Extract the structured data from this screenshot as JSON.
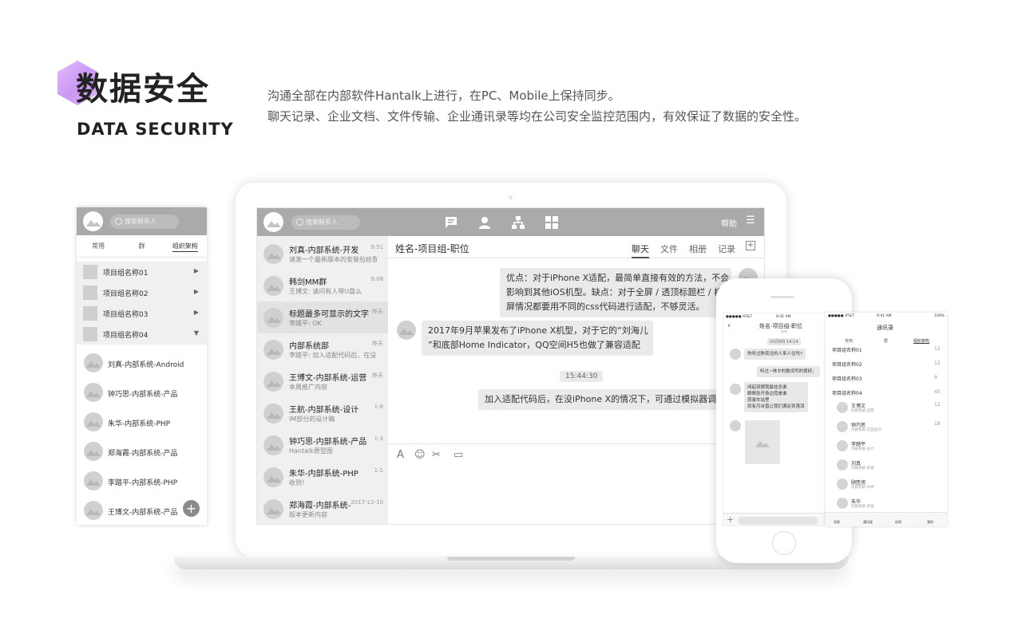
{
  "header": {
    "title_cn": "数据安全",
    "title_en": "DATA SECURITY",
    "desc_line1": "沟通全部在内部软件Hantalk上进行，在PC、Mobile上保持同步。",
    "desc_line2": "聊天记录、企业文档、文件传输、企业通讯录等均在公司安全监控范围内，有效保证了数据的安全性。"
  },
  "left_panel": {
    "search_placeholder": "搜索联系人",
    "tabs": [
      "常用",
      "群",
      "组织架构"
    ],
    "groups": [
      {
        "label": "项目组名称01",
        "arrow": "▶"
      },
      {
        "label": "项目组名称02",
        "arrow": "▶"
      },
      {
        "label": "项目组名称03",
        "arrow": "▶"
      },
      {
        "label": "项目组名称04",
        "arrow": "▼"
      }
    ],
    "members": [
      "刘真-内部系统-Android",
      "钟巧思-内部系统-产品",
      "朱华-内部系统-PHP",
      "郑海霞-内部系统-产品",
      "李踏平-内部系统-PHP",
      "王博文-内部系统-产品"
    ],
    "plus_icon": "+"
  },
  "desktop": {
    "search_placeholder": "搜索联系人",
    "help": "帮助",
    "menu_icon": "☰",
    "conversations": [
      {
        "name": "刘真-内部系统-开发",
        "preview": "请发一个最新版本的安装包给我",
        "time": "9:51"
      },
      {
        "name": "韩剑MM群",
        "preview": "王博文: 请问有人带U盘么",
        "time": "9:08"
      },
      {
        "name": "标题最多可显示的文字",
        "preview": "李踏平: OK",
        "time": "昨天"
      },
      {
        "name": "内部系统部",
        "preview": "李踏平: 加入适配代码后，在没",
        "time": "昨天"
      },
      {
        "name": "王博文-内部系统-运营",
        "preview": "本周推广内容",
        "time": "昨天"
      },
      {
        "name": "王航-内部系统-设计",
        "preview": "IM部分的设计稿",
        "time": "1-8"
      },
      {
        "name": "钟巧思-内部系统-产品",
        "preview": "Hantalk原型图",
        "time": "1-3"
      },
      {
        "name": "朱华-内部系统-PHP",
        "preview": "收到！",
        "time": "1-1"
      },
      {
        "name": "郑海霞-内部系统-",
        "preview": "版本更新内容",
        "time": "2017-12-10"
      }
    ],
    "chat_title": "姓名-项目组-职位",
    "chat_tabs": [
      "聊天",
      "文件",
      "相册",
      "记录"
    ],
    "add_icon": "+",
    "msg1_l1": "优点：对于iPhone X适配，最简单直接有效的方法，不会",
    "msg1_l2": "影响到其他iOS机型。缺点：对于全屏 / 透顶标题栏 / 横",
    "msg1_l3": "屏情况都要用不同的css代码进行适配，不够灵活。",
    "msg2_l1": "2017年9月苹果发布了iPhone X机型，对于它的“刘海儿",
    "msg2_l2": "”和底部Home Indicator，QQ空间H5也做了兼容适配",
    "timestamp": "15:44:30",
    "msg3": "加入适配代码后，在没iPhone X的情况下，可通过模拟器调试",
    "tool_icons": [
      "A",
      "☺",
      "✂",
      "▭"
    ]
  },
  "phone_chat": {
    "status_carrier": "●●●●● AT&T",
    "status_time": "9:41 AM",
    "back_icon": "‹",
    "title": "姓名-项目组-职位",
    "subtitle": "在线",
    "date": "10月9日 14:14",
    "m1": "你听过陈奕迅的人来人往吗?",
    "m2": "听过~林夕的歌词写的很好。",
    "m3_l1": "闭起双眼我最挂念谁",
    "m3_l2": "眼睛张开身边竟是谁",
    "m3_l3": "感激车站里",
    "m3_l4": "尚有月台曾让我们满足到落泪",
    "plus_icon": "+"
  },
  "phone_contacts": {
    "status_carrier": "●●●●● AT&T",
    "status_time": "9:41 AM",
    "status_battery": "100%",
    "title": "通讯录",
    "tabs": [
      "常用",
      "群",
      "组织架构"
    ],
    "groups": [
      {
        "label": "项目组名称01",
        "count": "12"
      },
      {
        "label": "项目组名称02",
        "count": "12"
      },
      {
        "label": "项目组名称03",
        "count": "9"
      },
      {
        "label": "项目组名称04",
        "count": "45"
      }
    ],
    "members": [
      {
        "name": "王博文",
        "role": "内部系统-运营",
        "count": "12"
      },
      {
        "name": "钟巧思",
        "role": "内部系统-交互设计",
        "count": "18"
      },
      {
        "name": "李踏平",
        "role": "内部系统-设计",
        "count": ""
      },
      {
        "name": "刘真",
        "role": "内部系统-开发",
        "count": ""
      },
      {
        "name": "顾医旭",
        "role": "内部系统-PHP",
        "count": ""
      },
      {
        "name": "朱华",
        "role": "内部系统-开发",
        "count": ""
      }
    ],
    "nav": [
      "消息",
      "通讯录",
      "应用",
      "我的"
    ]
  }
}
